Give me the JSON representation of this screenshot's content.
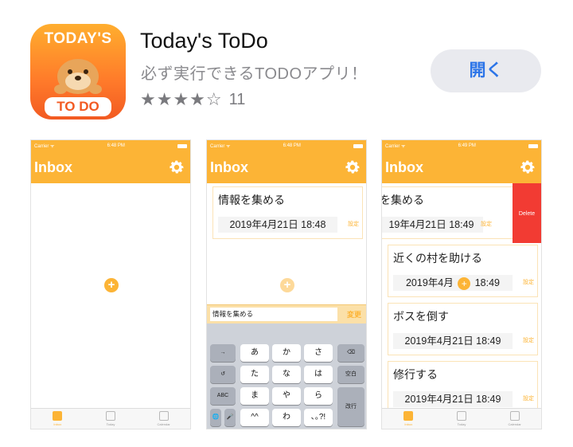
{
  "app": {
    "icon_text_top": "TODAY'S",
    "icon_text_bottom": "TO DO",
    "title": "Today's ToDo",
    "subtitle": "必ず実行できるTODOアプリ！",
    "stars": "★★★★☆",
    "rating_count": "11",
    "open_label": "開く"
  },
  "colors": {
    "accent": "#fcb436",
    "link": "#2b74e8",
    "delete": "#f23b33"
  },
  "screens": [
    {
      "status": {
        "carrier": "Carrier ᯤ",
        "time": "6:48 PM"
      },
      "nav_title": "Inbox",
      "tabs": [
        "Inbox",
        "Today",
        "Calendar"
      ]
    },
    {
      "status": {
        "carrier": "Carrier ᯤ",
        "time": "6:48 PM"
      },
      "nav_title": "Inbox",
      "task": {
        "title": "情報を集める",
        "date": "2019年4月21日 18:48",
        "setting": "設定"
      },
      "input_value": "情報を集める",
      "change_label": "変更",
      "keys": {
        "row1": [
          "→",
          "あ",
          "か",
          "さ",
          "⌫"
        ],
        "row2": [
          "↺",
          "た",
          "な",
          "は",
          "空白"
        ],
        "row3": [
          "ABC",
          "ま",
          "や",
          "ら",
          "改行"
        ],
        "row4": [
          "🌐",
          "🎤",
          "^^",
          "わ",
          "､｡?!"
        ]
      }
    },
    {
      "status": {
        "carrier": "Carrier ᯤ",
        "time": "6:49 PM"
      },
      "nav_title": "Inbox",
      "delete_label": "Delete",
      "tasks": [
        {
          "title": "を集める",
          "date": "19年4月21日 18:49",
          "setting": "設定"
        },
        {
          "title": "近くの村を助ける",
          "date": "2019年4月",
          "date_tail": "18:49",
          "setting": "設定"
        },
        {
          "title": "ボスを倒す",
          "date": "2019年4月21日 18:49",
          "setting": "設定"
        },
        {
          "title": "修行する",
          "date": "2019年4月21日 18:49",
          "setting": "設定"
        }
      ],
      "tabs": [
        "Inbox",
        "Today",
        "Calendar"
      ]
    }
  ]
}
